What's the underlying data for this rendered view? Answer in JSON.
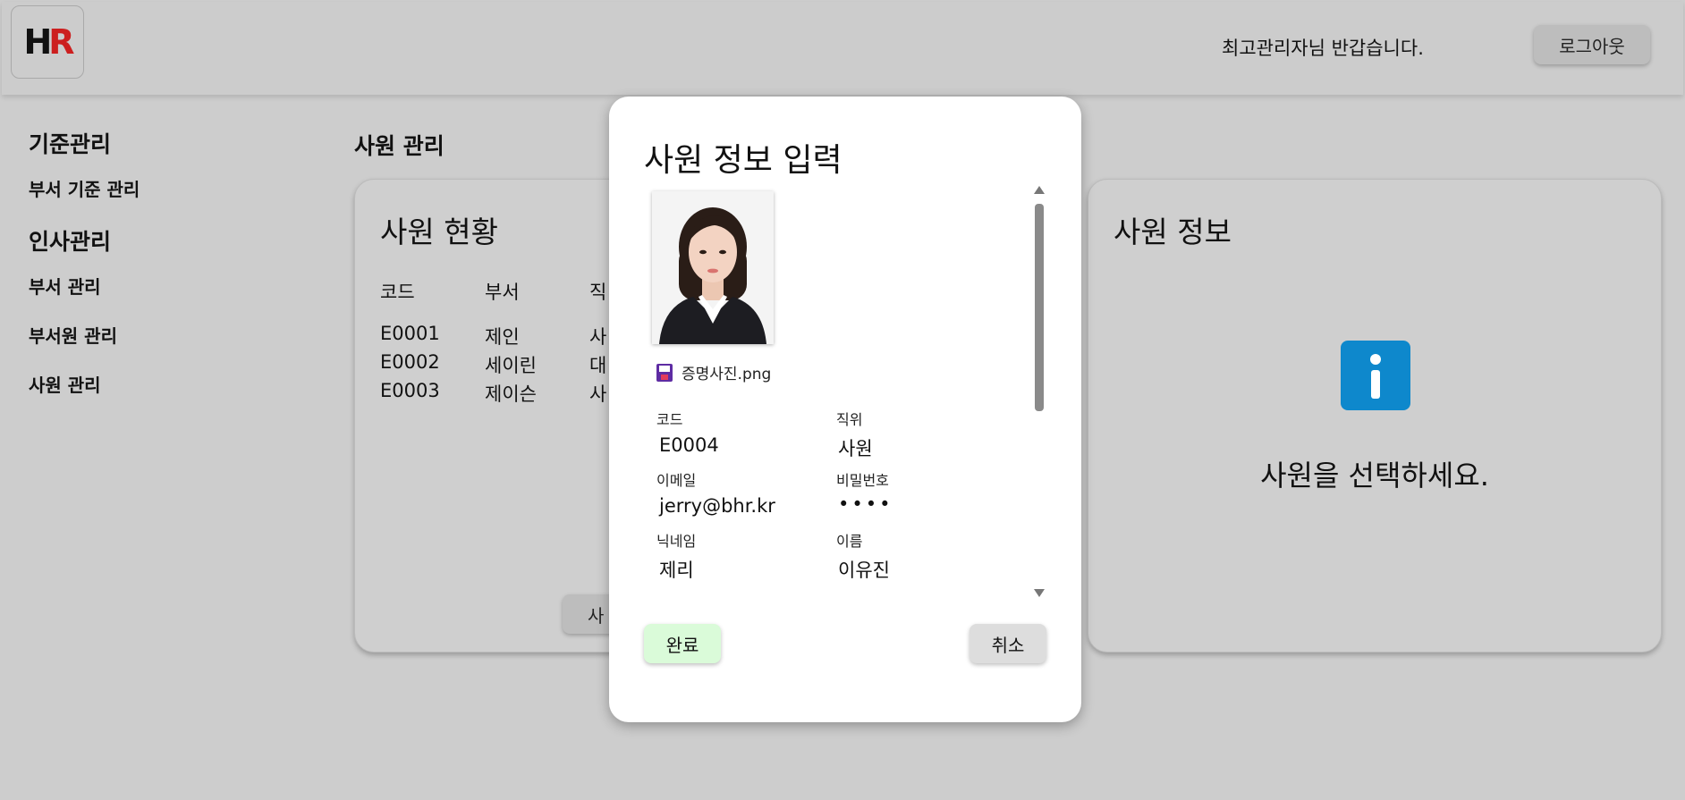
{
  "header": {
    "logo_h": "H",
    "logo_r": "R",
    "greeting": "최고관리자님 반갑습니다.",
    "logout_label": "로그아웃"
  },
  "sidebar": {
    "section1": "기준관리",
    "section1_items": [
      "부서 기준 관리"
    ],
    "section2": "인사관리",
    "section2_items": [
      "부서 관리",
      "부서원 관리",
      "사원 관리"
    ]
  },
  "page_title": "사원 관리",
  "employee_list": {
    "title": "사원 현황",
    "columns": [
      "코드",
      "부서",
      "직"
    ],
    "rows": [
      [
        "E0001",
        "제인",
        "사"
      ],
      [
        "E0002",
        "세이린",
        "대"
      ],
      [
        "E0003",
        "제이슨",
        "사"
      ]
    ],
    "add_button": "사"
  },
  "employee_info": {
    "title": "사원 정보",
    "message": "사원을 선택하세요.",
    "icon": "info-icon",
    "icon_color": "#0e88cc"
  },
  "modal": {
    "title": "사원 정보 입력",
    "photo_filename": "증명사진.png",
    "fields": {
      "code_label": "코드",
      "code_value": "E0004",
      "position_label": "직위",
      "position_value": "사원",
      "email_label": "이메일",
      "email_value": "jerry@bhr.kr",
      "password_label": "비밀번호",
      "password_value": "••••",
      "nickname_label": "닉네임",
      "nickname_value": "제리",
      "name_label": "이름",
      "name_value": "이유진"
    },
    "done_label": "완료",
    "cancel_label": "취소",
    "done_color": "#dafbd9"
  }
}
